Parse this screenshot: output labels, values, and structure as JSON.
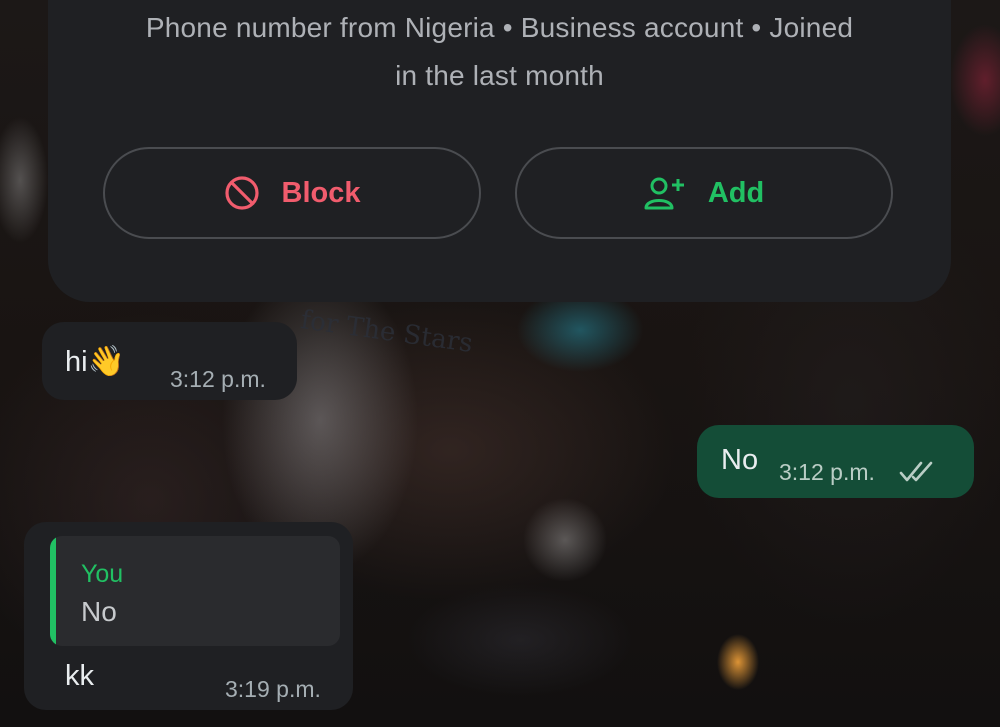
{
  "contact_info": {
    "details_line1": "Phone number from Nigeria • Business account • Joined",
    "details_line2": "in the last month",
    "block_label": "Block",
    "add_label": "Add",
    "block_icon": "block-icon",
    "add_icon": "add-contact-icon"
  },
  "messages": [
    {
      "direction": "incoming",
      "text": "hi",
      "emoji": "👋",
      "time": "3:12 p.m."
    },
    {
      "direction": "outgoing",
      "text": "No",
      "time": "3:12 p.m.",
      "status": "read-double-check"
    },
    {
      "direction": "incoming",
      "quoted_author": "You",
      "quoted_text": "No",
      "text": "kk",
      "time": "3:19 p.m."
    }
  ],
  "wallpaper": {
    "printed_text": "for The Stars"
  },
  "colors": {
    "background": "#0e0f11",
    "card": "#1f2023",
    "outgoing_bubble": "#144d37",
    "accent_green": "#21c063",
    "danger_red": "#f15c6d",
    "secondary_text": "#aeb1b6"
  }
}
